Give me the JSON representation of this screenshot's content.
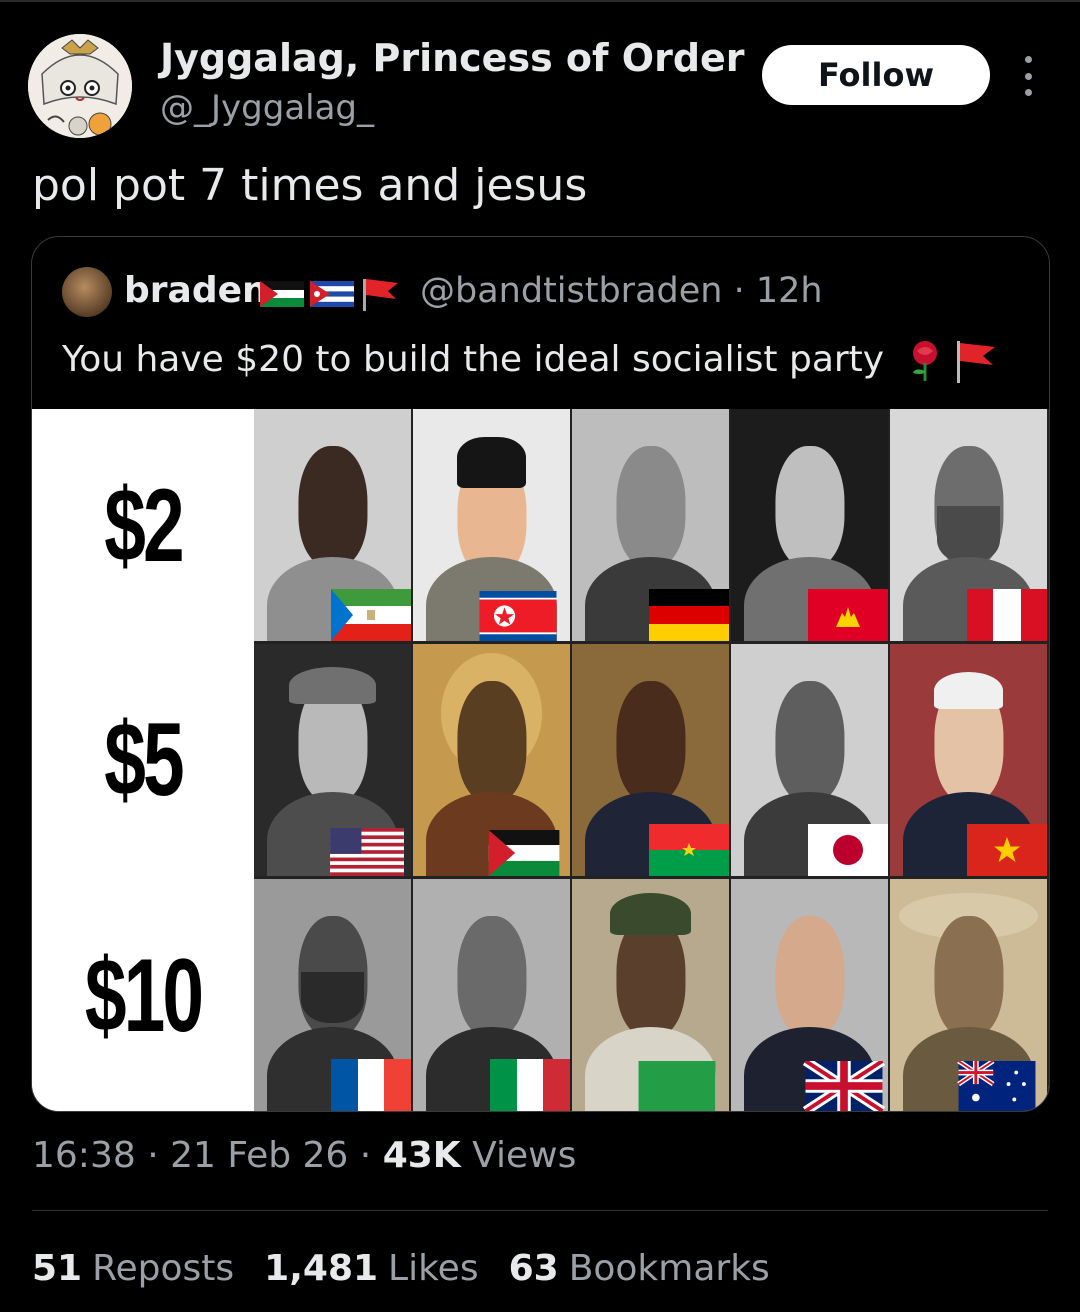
{
  "author": {
    "display_name": "Jyggalag, Princess of Order",
    "handle": "@_Jyggalag_",
    "follow_label": "Follow"
  },
  "tweet_text": "pol pot 7 times and jesus",
  "quoted": {
    "display_name": "braden",
    "handle_time": "@bandtistbraden · 12h",
    "text": "You have $20 to build the ideal socialist party",
    "emojis": [
      "rose-icon",
      "red-flag-icon"
    ],
    "prices": [
      "$2",
      "$5",
      "$10"
    ],
    "rows": [
      [
        "equatorial-guinea",
        "north-korea",
        "germany",
        "cambodia",
        "peru"
      ],
      [
        "usa",
        "palestine",
        "burkina-faso",
        "japan",
        "vietnam"
      ],
      [
        "france",
        "italy",
        "libya",
        "uk",
        "australia"
      ]
    ]
  },
  "meta": {
    "time": "16:38",
    "date": "21 Feb 26",
    "views_count": "43K",
    "views_label": "Views"
  },
  "stats": {
    "reposts_count": "51",
    "reposts_label": "Reposts",
    "likes_count": "1,481",
    "likes_label": "Likes",
    "bookmarks_count": "63",
    "bookmarks_label": "Bookmarks"
  },
  "colors": {
    "background": "#000000",
    "text": "#e7e9ea",
    "secondary": "#9aa0a6",
    "follow_bg": "#ffffff"
  }
}
